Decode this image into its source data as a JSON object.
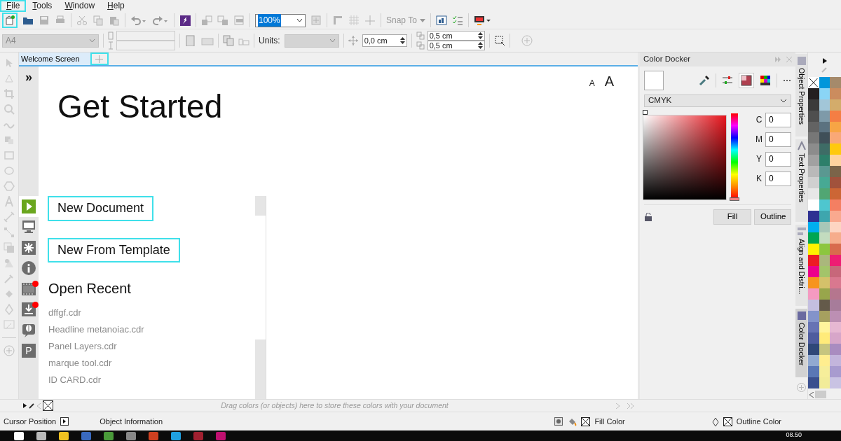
{
  "menu": [
    {
      "label": "File",
      "highlighted": true
    },
    {
      "label": "Tools",
      "highlighted": false
    },
    {
      "label": "Window",
      "highlighted": false
    },
    {
      "label": "Help",
      "highlighted": false
    }
  ],
  "toolbar": {
    "new_highlighted": true,
    "zoom": {
      "value": "100%",
      "text_selected": true
    },
    "snap_to": "Snap To"
  },
  "property_bar": {
    "page_size": "A4",
    "units_label": "Units:",
    "nudge": "0,0 cm",
    "duplicate_x": "0,5 cm",
    "duplicate_y": "0,5 cm"
  },
  "tabs": [
    {
      "label": "Welcome Screen",
      "selected": true
    }
  ],
  "new_tab_button": {
    "highlighted": true
  },
  "welcome": {
    "collapse_glyph": "»",
    "font_sizes": [
      "A",
      "A"
    ],
    "title": "Get Started",
    "nav": [
      {
        "kind": "play",
        "selected": true,
        "notification": false
      },
      {
        "kind": "monitor",
        "selected": false,
        "notification": false
      },
      {
        "kind": "burst",
        "selected": false,
        "notification": false
      },
      {
        "kind": "info",
        "selected": false,
        "notification": false
      },
      {
        "kind": "film",
        "selected": false,
        "notification": true
      },
      {
        "kind": "download",
        "selected": false,
        "notification": true
      },
      {
        "kind": "balloon",
        "selected": false,
        "notification": false
      },
      {
        "kind": "letter",
        "glyph": "P",
        "selected": false,
        "notification": false
      }
    ],
    "actions": [
      {
        "label": "New Document",
        "highlighted": true
      },
      {
        "label": "New From Template",
        "highlighted": true
      }
    ],
    "recent_heading": "Open Recent",
    "recent_files": [
      "dffgf.cdr",
      "Headline metanoiac.cdr",
      "Panel Layers.cdr",
      "marque tool.cdr",
      "ID CARD.cdr"
    ]
  },
  "color_docker": {
    "title": "Color Docker",
    "model": "CMYK",
    "hue": {
      "level": 0
    },
    "channels": [
      {
        "label": "C",
        "value": "0"
      },
      {
        "label": "M",
        "value": "0"
      },
      {
        "label": "Y",
        "value": "0"
      },
      {
        "label": "K",
        "value": "0"
      }
    ],
    "buttons": [
      "Fill",
      "Outline"
    ]
  },
  "docker_tabs": [
    {
      "label": "Object Properties",
      "selected": false
    },
    {
      "label": "Text Properties",
      "selected": false
    },
    {
      "label": "Align and Distri...",
      "selected": false
    },
    {
      "label": "Color Docker",
      "selected": true
    }
  ],
  "palette": [
    {
      "kind": "none"
    },
    {
      "kind": "swatch",
      "color": "#0096db"
    },
    {
      "kind": "swatch",
      "color": "#a58a6b"
    },
    {
      "kind": "swatch",
      "color": "#231f20"
    },
    {
      "kind": "swatch",
      "color": "#8ad5f6"
    },
    {
      "kind": "swatch",
      "color": "#cb8c5e"
    },
    {
      "kind": "swatch",
      "color": "#3b3b3b"
    },
    {
      "kind": "swatch",
      "color": "#a2c6d8"
    },
    {
      "kind": "swatch",
      "color": "#d3ac6b"
    },
    {
      "kind": "swatch",
      "color": "#4f4f4f"
    },
    {
      "kind": "swatch",
      "color": "#7e9aa9"
    },
    {
      "kind": "swatch",
      "color": "#f47e44"
    },
    {
      "kind": "swatch",
      "color": "#636363"
    },
    {
      "kind": "swatch",
      "color": "#5b7280"
    },
    {
      "kind": "swatch",
      "color": "#f7a545"
    },
    {
      "kind": "swatch",
      "color": "#777777"
    },
    {
      "kind": "swatch",
      "color": "#3f4f58"
    },
    {
      "kind": "swatch",
      "color": "#f9a877"
    },
    {
      "kind": "swatch",
      "color": "#8c8c8c"
    },
    {
      "kind": "swatch",
      "color": "#3e6c66"
    },
    {
      "kind": "swatch",
      "color": "#ffc90e"
    },
    {
      "kind": "swatch",
      "color": "#a1a1a1"
    },
    {
      "kind": "swatch",
      "color": "#2d7f6a"
    },
    {
      "kind": "swatch",
      "color": "#ffd39f"
    },
    {
      "kind": "swatch",
      "color": "#b9b9b9"
    },
    {
      "kind": "swatch",
      "color": "#5a9891"
    },
    {
      "kind": "swatch",
      "color": "#7b6449"
    },
    {
      "kind": "swatch",
      "color": "#d0d0d0"
    },
    {
      "kind": "swatch",
      "color": "#47a994"
    },
    {
      "kind": "swatch",
      "color": "#a1523c"
    },
    {
      "kind": "swatch",
      "color": "#e7e7e7"
    },
    {
      "kind": "swatch",
      "color": "#51a673"
    },
    {
      "kind": "swatch",
      "color": "#cc6635"
    },
    {
      "kind": "swatch",
      "color": "#ffffff"
    },
    {
      "kind": "swatch",
      "color": "#4ec6cf"
    },
    {
      "kind": "swatch",
      "color": "#f47f62"
    },
    {
      "kind": "swatch",
      "color": "#2e3192"
    },
    {
      "kind": "swatch",
      "color": "#3ea6ae"
    },
    {
      "kind": "swatch",
      "color": "#f9a98f"
    },
    {
      "kind": "swatch",
      "color": "#00aeef"
    },
    {
      "kind": "swatch",
      "color": "#a8c7b8"
    },
    {
      "kind": "swatch",
      "color": "#fdd5c2"
    },
    {
      "kind": "swatch",
      "color": "#00a651"
    },
    {
      "kind": "swatch",
      "color": "#c3dcbf"
    },
    {
      "kind": "swatch",
      "color": "#f6ad8c"
    },
    {
      "kind": "swatch",
      "color": "#fff200"
    },
    {
      "kind": "swatch",
      "color": "#8cc63f"
    },
    {
      "kind": "swatch",
      "color": "#d86b4d"
    },
    {
      "kind": "swatch",
      "color": "#ed1c24"
    },
    {
      "kind": "swatch",
      "color": "#aab77c"
    },
    {
      "kind": "swatch",
      "color": "#ee1c73"
    },
    {
      "kind": "swatch",
      "color": "#ec008c"
    },
    {
      "kind": "swatch",
      "color": "#a3c46a"
    },
    {
      "kind": "swatch",
      "color": "#c7677a"
    },
    {
      "kind": "swatch",
      "color": "#f7941d"
    },
    {
      "kind": "swatch",
      "color": "#d4c16a"
    },
    {
      "kind": "swatch",
      "color": "#d9788f"
    },
    {
      "kind": "swatch",
      "color": "#f49ac1"
    },
    {
      "kind": "swatch",
      "color": "#98a64b"
    },
    {
      "kind": "swatch",
      "color": "#b5768e"
    },
    {
      "kind": "swatch",
      "color": "#c4bfe0"
    },
    {
      "kind": "swatch",
      "color": "#645a4a"
    },
    {
      "kind": "swatch",
      "color": "#a77c9a"
    },
    {
      "kind": "swatch",
      "color": "#8393ca"
    },
    {
      "kind": "swatch",
      "color": "#a6a05f"
    },
    {
      "kind": "swatch",
      "color": "#bc8fb3"
    },
    {
      "kind": "swatch",
      "color": "#6773b4"
    },
    {
      "kind": "swatch",
      "color": "#fff49c"
    },
    {
      "kind": "swatch",
      "color": "#e6b8d2"
    },
    {
      "kind": "swatch",
      "color": "#4f5c9e"
    },
    {
      "kind": "swatch",
      "color": "#ffeb7a"
    },
    {
      "kind": "swatch",
      "color": "#d7a6c9"
    },
    {
      "kind": "swatch",
      "color": "#2f4778"
    },
    {
      "kind": "swatch",
      "color": "#c6c57f"
    },
    {
      "kind": "swatch",
      "color": "#a98cc0"
    },
    {
      "kind": "swatch",
      "color": "#91a9d1"
    },
    {
      "kind": "swatch",
      "color": "#ffee8f"
    },
    {
      "kind": "swatch",
      "color": "#c3b5dc"
    },
    {
      "kind": "swatch",
      "color": "#5a77b5"
    },
    {
      "kind": "swatch",
      "color": "#f6ee9a"
    },
    {
      "kind": "swatch",
      "color": "#a89bcf"
    },
    {
      "kind": "swatch",
      "color": "#3a4f8e"
    },
    {
      "kind": "swatch",
      "color": "#f2ec99"
    },
    {
      "kind": "swatch",
      "color": "#c9c3e3"
    }
  ],
  "document_palette": {
    "hint": "Drag colors (or objects) here to store these colors with your document"
  },
  "status_bar": {
    "cursor_position": "Cursor Position",
    "object_information": "Object Information",
    "fill": "Fill Color",
    "outline": "Outline Color"
  },
  "taskbar": {
    "time": "08.50"
  }
}
